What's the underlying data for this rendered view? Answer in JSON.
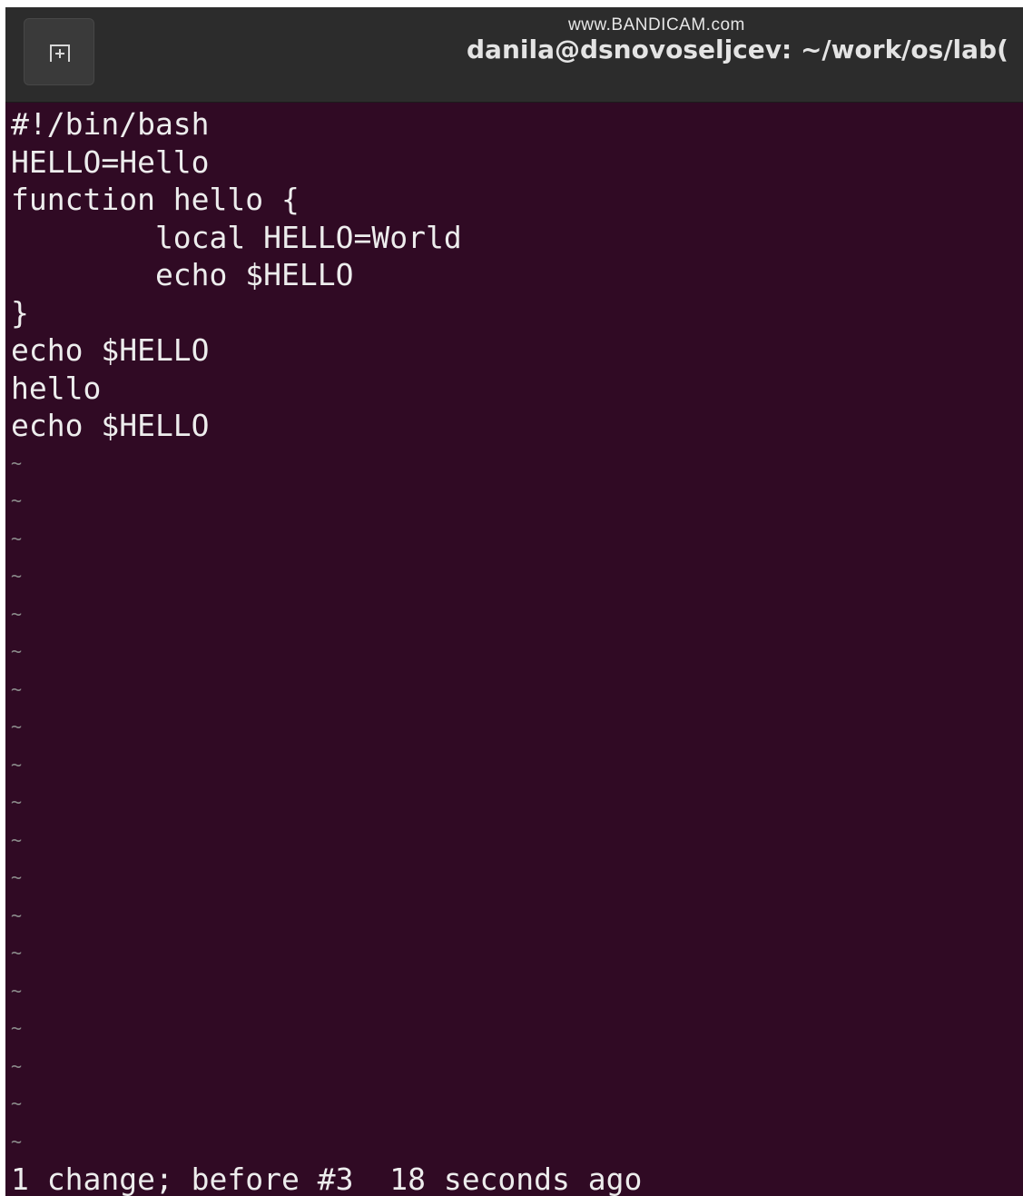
{
  "titlebar": {
    "watermark": "www.BANDICAM.com",
    "title": "danila@dsnovoseljcev: ~/work/os/lab("
  },
  "icons": {
    "new_tab": "new-tab-icon"
  },
  "editor": {
    "lines": [
      "#!/bin/bash",
      "HELLO=Hello",
      "function hello {",
      "        local HELLO=World",
      "        echo $HELLO",
      "}",
      "echo $HELLO",
      "hello",
      "echo $HELLO"
    ],
    "empty_line_marker": "~",
    "empty_line_count": 19
  },
  "status": "1 change; before #3  18 seconds ago",
  "colors": {
    "terminal_bg": "#300a24",
    "titlebar_bg": "#2c2c2c",
    "text": "#ededed",
    "tilde": "#8a8a8a"
  }
}
